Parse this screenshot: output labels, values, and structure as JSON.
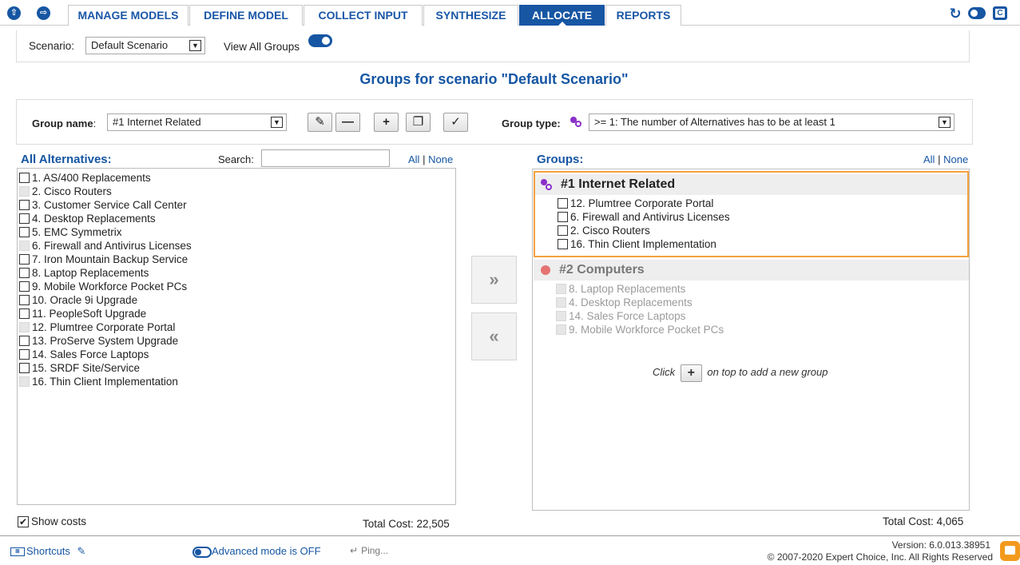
{
  "nav": {
    "tabs": [
      "MANAGE MODELS",
      "DEFINE MODEL",
      "COLLECT INPUT",
      "SYNTHESIZE",
      "ALLOCATE",
      "REPORTS"
    ],
    "active_tab": "ALLOCATE",
    "back_icon": "up-arrow-circle-icon",
    "forward_icon": "right-arrow-circle-icon",
    "right_icons": [
      "refresh-icon",
      "toggle-icon",
      "capture-icon"
    ]
  },
  "scenario": {
    "label": "Scenario:",
    "value": "Default Scenario",
    "view_all_label": "View All Groups"
  },
  "page_title": "Groups for scenario \"Default Scenario\"",
  "group_bar": {
    "name_label": "Group name",
    "name_value": "#1 Internet Related",
    "type_label": "Group type:",
    "type_value": ">= 1: The number of Alternatives has to be at least 1"
  },
  "alternatives": {
    "title": "All Alternatives:",
    "search_label": "Search:",
    "search_value": "",
    "all_label": "All",
    "sep": "|",
    "none_label": "None",
    "items": [
      {
        "label": "1. AS/400 Replacements",
        "disabled": false
      },
      {
        "label": "2. Cisco Routers",
        "disabled": true
      },
      {
        "label": "3. Customer Service Call Center",
        "disabled": false
      },
      {
        "label": "4. Desktop Replacements",
        "disabled": false
      },
      {
        "label": "5. EMC Symmetrix",
        "disabled": false
      },
      {
        "label": "6. Firewall and Antivirus Licenses",
        "disabled": true
      },
      {
        "label": "7. Iron Mountain Backup Service",
        "disabled": false
      },
      {
        "label": "8. Laptop Replacements",
        "disabled": false
      },
      {
        "label": "9. Mobile Workforce Pocket PCs",
        "disabled": false
      },
      {
        "label": "10. Oracle 9i Upgrade",
        "disabled": false
      },
      {
        "label": "11. PeopleSoft Upgrade",
        "disabled": false
      },
      {
        "label": "12. Plumtree Corporate Portal",
        "disabled": true
      },
      {
        "label": "13. ProServe System Upgrade",
        "disabled": false
      },
      {
        "label": "14. Sales Force Laptops",
        "disabled": false
      },
      {
        "label": "15. SRDF Site/Service",
        "disabled": false
      },
      {
        "label": "16. Thin Client Implementation",
        "disabled": true
      }
    ],
    "show_costs_label": "Show costs",
    "total_cost": "Total Cost: 22,505"
  },
  "transfer": {
    "add_label": "»",
    "remove_label": "«"
  },
  "groups": {
    "title": "Groups:",
    "all_label": "All",
    "sep": "|",
    "none_label": "None",
    "list": [
      {
        "name": "#1 Internet Related",
        "icon": "purple-link-icon",
        "items": [
          "12. Plumtree Corporate Portal",
          "6. Firewall and Antivirus Licenses",
          "2. Cisco Routers",
          "16. Thin Client Implementation"
        ]
      },
      {
        "name": "#2 Computers",
        "icon": "red-dot-icon",
        "items": [
          "8. Laptop Replacements",
          "4. Desktop Replacements",
          "14. Sales Force Laptops",
          "9. Mobile Workforce Pocket PCs"
        ]
      }
    ],
    "hint_pre": "Click",
    "hint_post": "on top to add a new group",
    "total_cost": "Total Cost: 4,065"
  },
  "footer": {
    "shortcuts_label": "Shortcuts",
    "advanced_mode": "Advanced mode is OFF",
    "ping": "Ping...",
    "version": "Version: 6.0.013.38951",
    "copyright": "© 2007-2020 Expert Choice, Inc. All Rights Reserved"
  },
  "colors": {
    "accent": "#1656a3",
    "highlight": "#f4a13e",
    "group1_icon": "#8b2fc9",
    "group2_icon": "#e57373"
  }
}
